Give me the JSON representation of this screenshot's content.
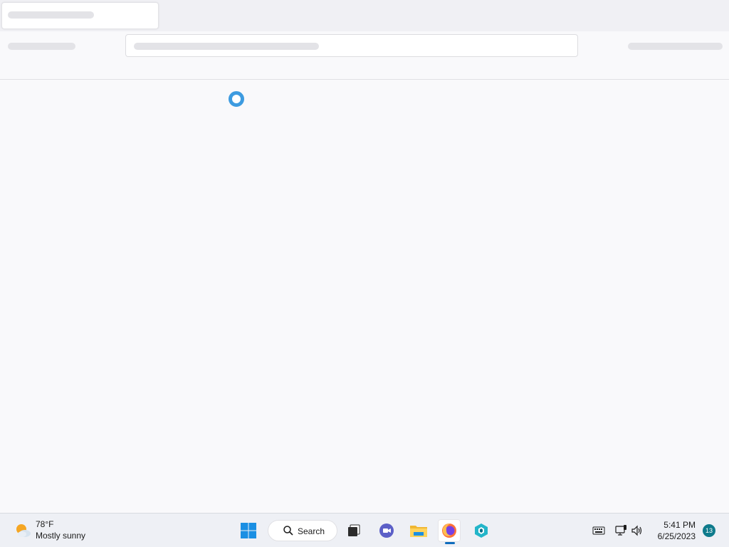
{
  "taskbar": {
    "weather": {
      "icon": "weather-partly-sunny-icon",
      "temperature": "78°F",
      "condition": "Mostly sunny"
    },
    "search_label": "Search",
    "pinned_apps": [
      {
        "name": "start-icon"
      },
      {
        "name": "task-view-icon"
      },
      {
        "name": "chat-icon"
      },
      {
        "name": "file-explorer-icon"
      },
      {
        "name": "firefox-icon",
        "active": true
      },
      {
        "name": "app-icon"
      }
    ],
    "tray": {
      "time": "5:41 PM",
      "date": "6/25/2023",
      "notification_count": "13"
    }
  },
  "colors": {
    "spinner": "#3d9be0",
    "page_background": "#f9f9fb",
    "taskbar_background": "#eef0f5",
    "notification_badge": "#0f7b8c",
    "active_indicator": "#0f6cbd"
  }
}
